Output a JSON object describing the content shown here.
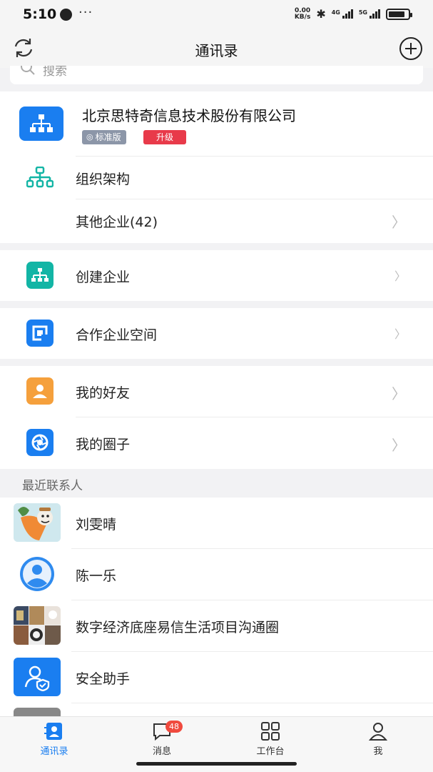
{
  "status_bar": {
    "time": "5:10",
    "more": "···",
    "net_speed_value": "0.00",
    "net_speed_unit": "KB/s",
    "sim1": "4G",
    "sim2": "5G",
    "battery_level": 0.85
  },
  "header": {
    "title": "通讯录",
    "refresh_icon": "refresh-icon",
    "add_icon": "add-circle-icon"
  },
  "search": {
    "placeholder": "搜索"
  },
  "company": {
    "name": "北京思特奇信息技术股份有限公司",
    "edition_badge": "标准版",
    "upgrade_badge": "升级",
    "items": [
      {
        "label": "组织架构",
        "icon": "org-chart-icon"
      },
      {
        "label": "其他企业(42)",
        "icon": ""
      }
    ]
  },
  "menu": {
    "create_company": "创建企业",
    "partner_space": "合作企业空间",
    "my_friends": "我的好友",
    "my_circles": "我的圈子"
  },
  "recent": {
    "title": "最近联系人",
    "contacts": [
      {
        "name": "刘雯晴"
      },
      {
        "name": "陈一乐"
      },
      {
        "name": "数字经济底座易信生活项目沟通圈"
      },
      {
        "name": "安全助手"
      }
    ]
  },
  "tabs": [
    {
      "label": "通讯录",
      "active": true
    },
    {
      "label": "消息",
      "badge": "48"
    },
    {
      "label": "工作台"
    },
    {
      "label": "我"
    }
  ],
  "colors": {
    "accent": "#1a7ef0",
    "teal": "#12b5a5",
    "orange": "#f5a03c",
    "badge_red": "#e83a4a"
  }
}
